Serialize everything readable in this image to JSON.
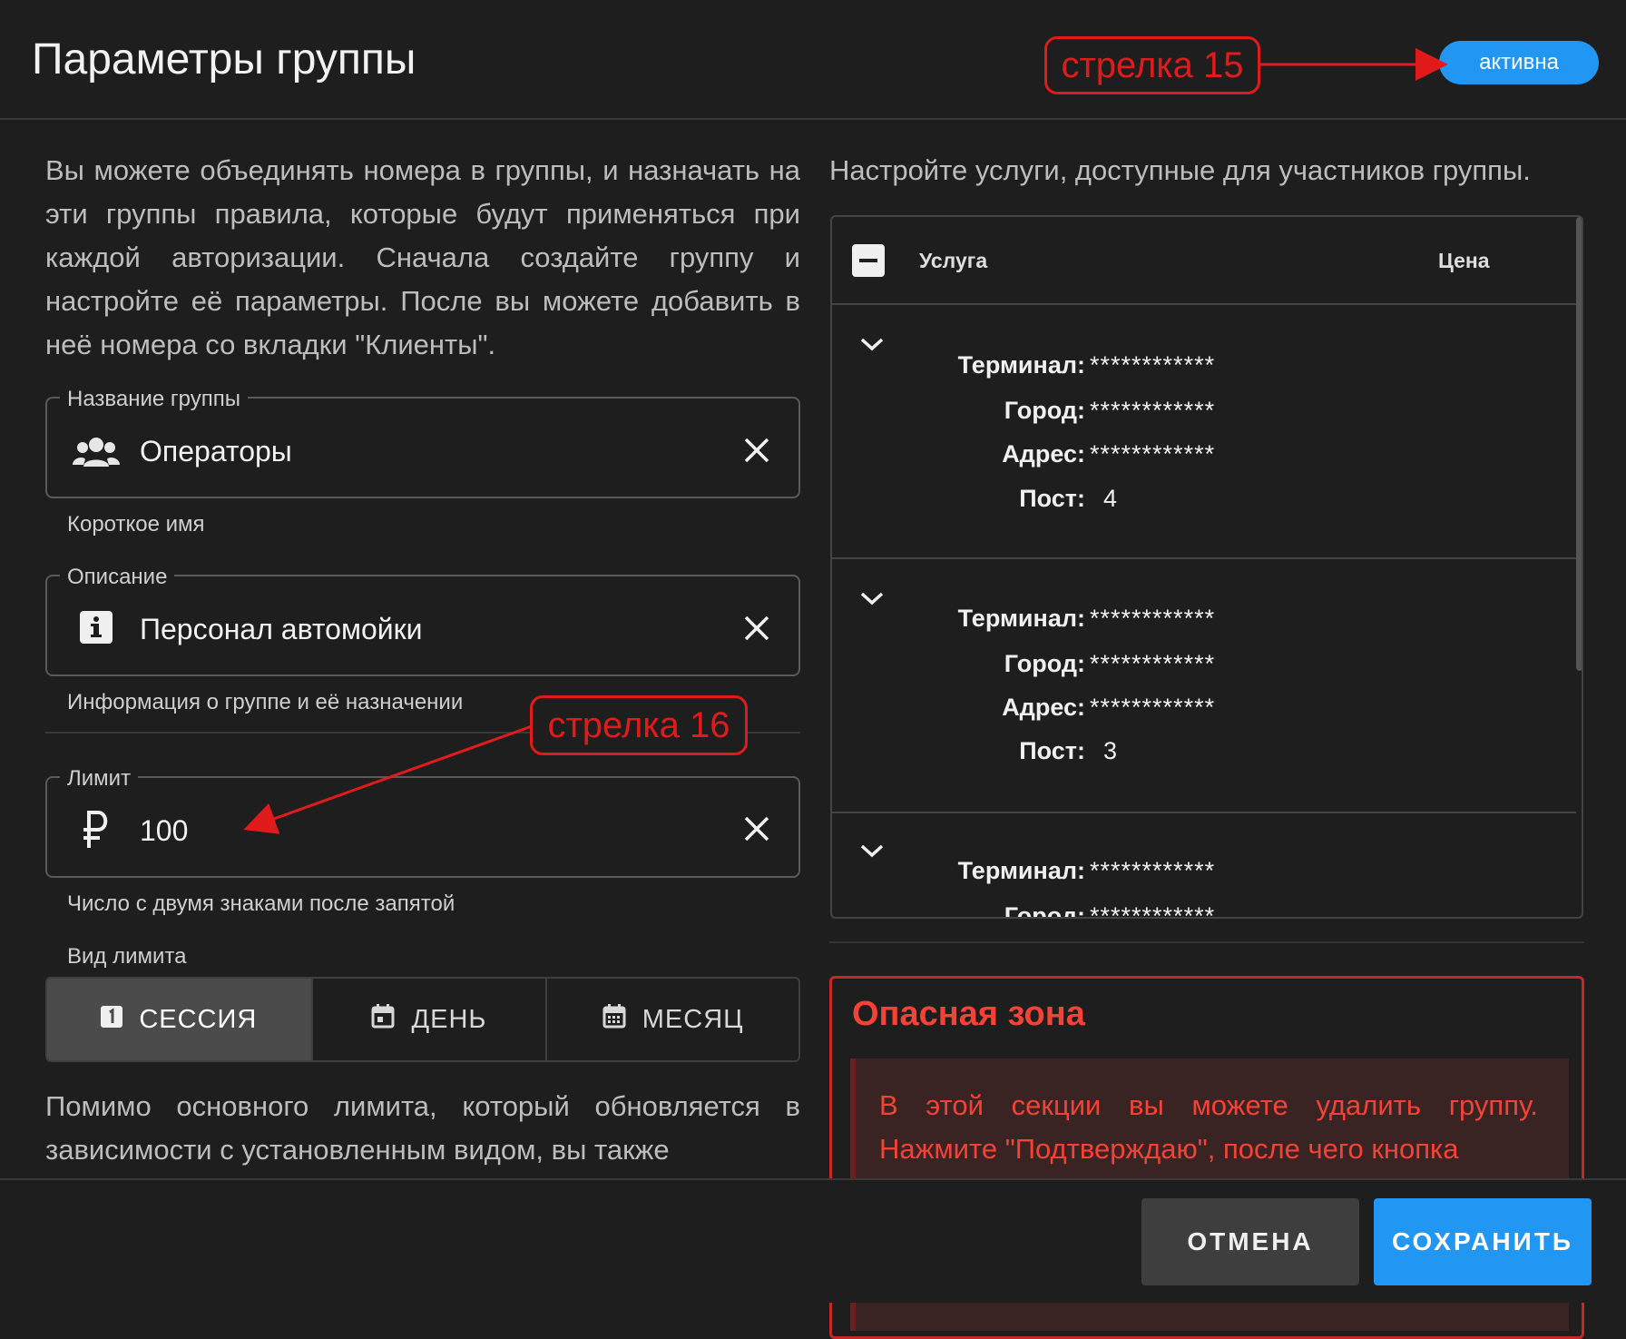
{
  "dialog": {
    "title": "Параметры группы",
    "status_label": "активна"
  },
  "annotations": {
    "callout_15": "стрелка 15",
    "callout_16": "стрелка 16"
  },
  "left": {
    "intro": "Вы можете объединять номера в группы, и назначать на эти группы правила, которые будут применяться при каждой авторизации. Сначала создайте группу и настройте её параметры. После вы можете добавить в неё номера со вкладки \"Клиенты\".",
    "group_name": {
      "label": "Название группы",
      "value": "Операторы",
      "helper": "Короткое имя",
      "icon": "group-icon"
    },
    "description": {
      "label": "Описание",
      "value": "Персонал автомойки",
      "helper": "Информация о группе и её назначении",
      "icon": "info-icon"
    },
    "limit": {
      "label": "Лимит",
      "value": "100",
      "helper": "Число с двумя знаками после запятой",
      "icon": "ruble-icon"
    },
    "limit_type": {
      "label": "Вид лимита",
      "options": [
        {
          "label": "СЕССИЯ",
          "icon": "one-square-icon",
          "selected": true
        },
        {
          "label": "ДЕНЬ",
          "icon": "calendar-day-icon",
          "selected": false
        },
        {
          "label": "МЕСЯЦ",
          "icon": "calendar-month-icon",
          "selected": false
        }
      ]
    },
    "extra_text": "Помимо основного лимита, который обновляется в зависимости с установленным видом, вы также"
  },
  "right": {
    "intro": "Настройте услуги, доступные для участников группы.",
    "table": {
      "col_service": "Услуга",
      "col_price": "Цена",
      "labels": {
        "terminal": "Терминал:",
        "city": "Город:",
        "address": "Адрес:",
        "post": "Пост:"
      },
      "rows": [
        {
          "terminal": "************",
          "city": "************",
          "address": "************",
          "post": "4"
        },
        {
          "terminal": "************",
          "city": "************",
          "address": "************",
          "post": "3"
        },
        {
          "terminal": "************",
          "city": "************"
        }
      ]
    },
    "danger": {
      "title": "Опасная зона",
      "text": "В этой секции вы можете удалить группу. Нажмите \"Подтверждаю\", после чего кнопка"
    }
  },
  "footer": {
    "cancel_label": "ОТМЕНА",
    "save_label": "СОХРАНИТЬ"
  },
  "colors": {
    "accent": "#2196f3",
    "danger": "#f44336",
    "annotation": "#e11b1b",
    "background": "#1e1e1f"
  }
}
